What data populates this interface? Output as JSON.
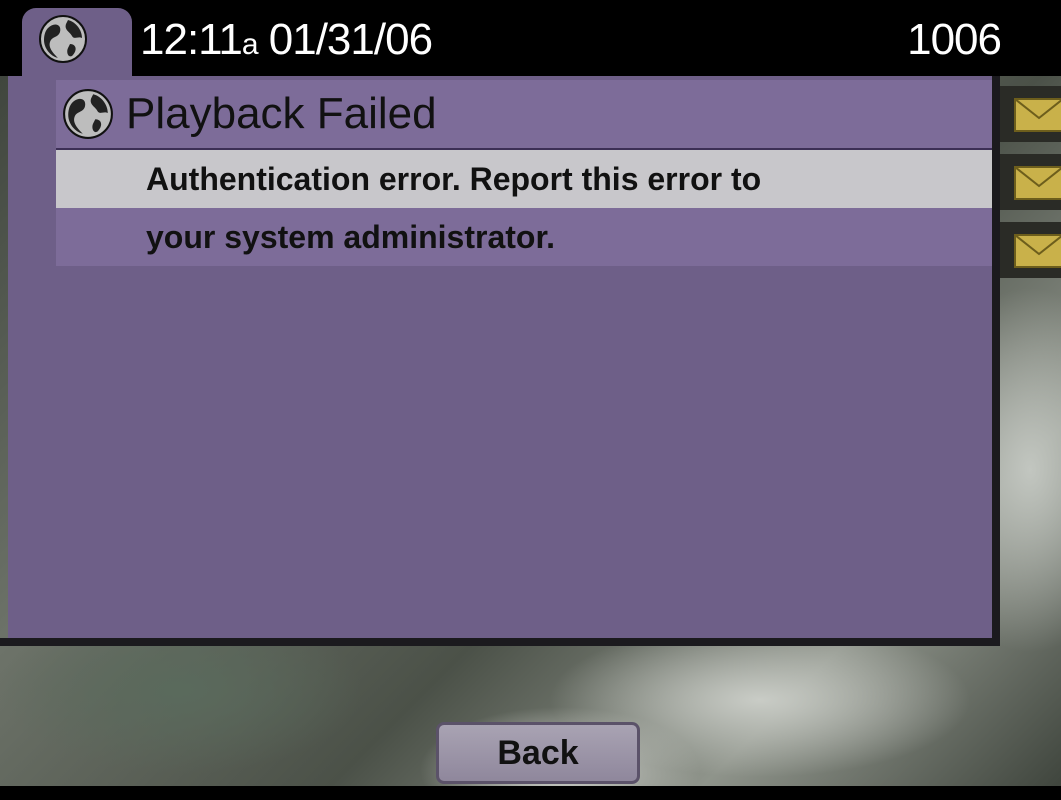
{
  "status_bar": {
    "time": "12:11",
    "ampm": "a",
    "date": "01/31/06",
    "extension": "1006",
    "icon": "globe-icon"
  },
  "dialog": {
    "title": "Playback Failed",
    "icon": "globe-icon",
    "message_line_1": "Authentication error. Report this error to",
    "message_line_2": "your system administrator."
  },
  "line_indicators": [
    {
      "icon": "envelope-icon"
    },
    {
      "icon": "envelope-icon"
    },
    {
      "icon": "envelope-icon"
    }
  ],
  "softkeys": {
    "back_label": "Back"
  },
  "colors": {
    "panel": "#6e5f88",
    "title_bar": "#7d6c99",
    "highlight_line": "#c8c7cb",
    "envelope": "#c9b14a"
  }
}
